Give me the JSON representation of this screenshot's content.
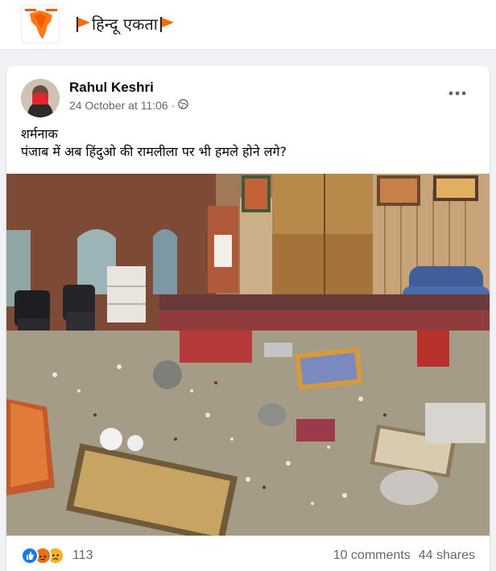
{
  "group": {
    "logo_icon": "map-of-india-logo",
    "name": "हिन्दू एकता",
    "flag_icon": "saffron-flag-icon"
  },
  "post": {
    "author": "Rahul Keshri",
    "timestamp": "24 October at 11:06",
    "separator": "·",
    "audience_icon": "globe-icon",
    "more_icon": "more-options-icon",
    "text_lines": [
      "शर्मनाक",
      "पंजाब में अब हिंदुओ की रामलीला पर भी हमले होने लगे?"
    ],
    "photo": "vandalized-hall-photo"
  },
  "footer": {
    "reaction_icons": [
      "like-icon",
      "angry-icon",
      "sad-icon"
    ],
    "reaction_count": "113",
    "comments": "10 comments",
    "shares": "44 shares"
  },
  "colors": {
    "like_blue": "#1877f2",
    "angry_orange": "#e9710f",
    "sad_yellow": "#f7b125",
    "flag_saffron": "#ff6a00",
    "secondary_text": "#65676b"
  }
}
